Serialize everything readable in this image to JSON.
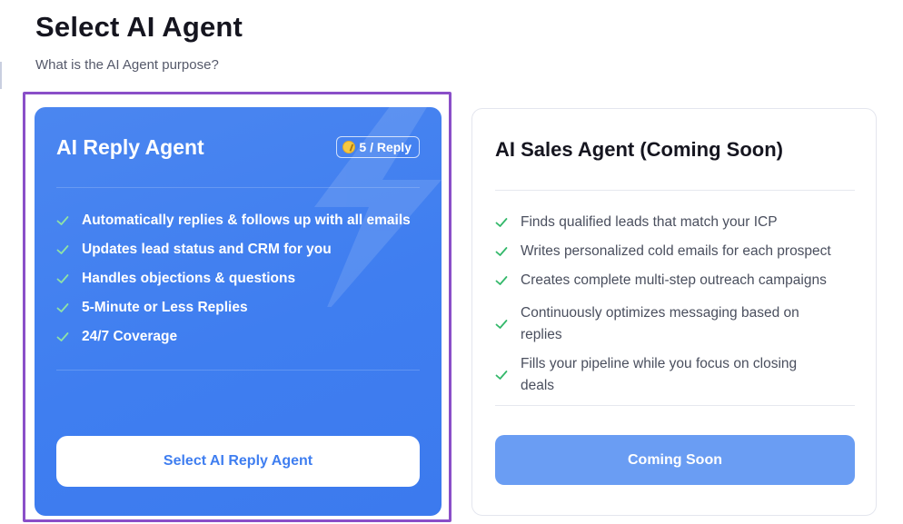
{
  "header": {
    "title": "Select AI Agent",
    "subtitle": "What is the AI Agent purpose?"
  },
  "agents": [
    {
      "title": "AI Reply Agent",
      "badge": {
        "icon": "coin-icon",
        "price": "5 / Reply"
      },
      "features": [
        "Automatically replies & follows up with all emails",
        "Updates lead status and CRM for you",
        "Handles objections & questions",
        "5-Minute or Less Replies",
        "24/7 Coverage"
      ],
      "button_label": "Select AI Reply Agent",
      "selected": true
    },
    {
      "title": "AI Sales Agent (Coming Soon)",
      "features": [
        "Finds qualified leads that match your ICP",
        "Writes personalized cold emails for each prospect",
        "Creates complete multi-step outreach campaigns",
        "Continuously optimizes messaging based on replies",
        "Fills your pipeline while you focus on closing deals"
      ],
      "button_label": "Coming Soon",
      "selected": false
    }
  ],
  "colors": {
    "primary": "#3f7ef0",
    "selection_border": "#8a4fc8",
    "check_green": "#33b86a",
    "disabled_button": "#6a9df3"
  }
}
